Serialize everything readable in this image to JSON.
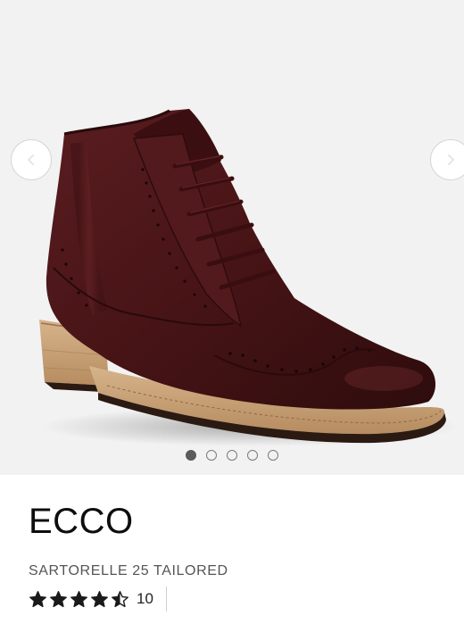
{
  "gallery": {
    "image_alt": "Burgundy leather lace-up wingtip ankle boot",
    "image_count": 5,
    "active_index": 0,
    "prev_icon": "chevron-left-icon",
    "next_icon": "chevron-right-icon"
  },
  "product": {
    "brand": "ECCO",
    "name": "SARTORELLE 25 TAILORED",
    "rating": 4.5,
    "rating_max": 5,
    "review_count": "10"
  },
  "colors": {
    "gallery_bg": "#f2f2f2",
    "leather": "#4a1618",
    "sole": "#c9a27a",
    "star": "#1a1a1a"
  }
}
